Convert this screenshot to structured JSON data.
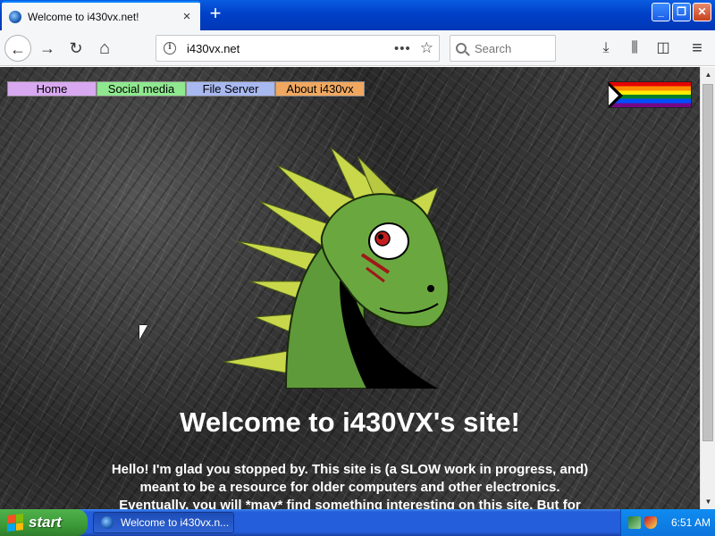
{
  "browser": {
    "tab": {
      "title": "Welcome to i430vx.net!",
      "close_icon": "×"
    },
    "new_tab_icon": "+",
    "window_buttons": {
      "minimize": "_",
      "restore": "❐",
      "close": "✕"
    },
    "nav": {
      "back_icon": "←",
      "forward_icon": "→",
      "reload_icon": "↻",
      "home_icon": "⌂"
    },
    "url": {
      "info_icon": "i",
      "address": "i430vx.net",
      "more_icon": "•••",
      "bookmark_icon": "☆"
    },
    "search": {
      "placeholder": "Search"
    },
    "tools": {
      "downloads_icon": "⤓",
      "library_icon": "⫼",
      "sidebar_icon": "◫",
      "menu_icon": "≡"
    }
  },
  "site": {
    "nav_links": [
      {
        "label": "Home",
        "color": "#d8a8f0"
      },
      {
        "label": "Social media",
        "color": "#8fe88f"
      },
      {
        "label": "File Server",
        "color": "#a8b8f0"
      },
      {
        "label": "About i430vx",
        "color": "#f0a860"
      }
    ],
    "headline": "Welcome to i430VX's site!",
    "intro_lines": [
      "Hello! I'm glad you stopped by. This site is (a SLOW work in progress, and)",
      "meant to be a resource for older computers and other electronics.",
      "Eventually, you will *may* find something interesting on this site. But for"
    ]
  },
  "scrollbar": {
    "up_icon": "▲",
    "down_icon": "▼"
  },
  "taskbar": {
    "start_label": "start",
    "task_label": "Welcome to i430vx.n...",
    "clock": "6:51 AM"
  },
  "colors": {
    "titlebar_blue": "#0041c8",
    "taskbar_blue": "#245edb",
    "start_green": "#3c9a38",
    "dragon_green": "#5f9a3a",
    "dragon_spikes": "#c8d84a"
  }
}
